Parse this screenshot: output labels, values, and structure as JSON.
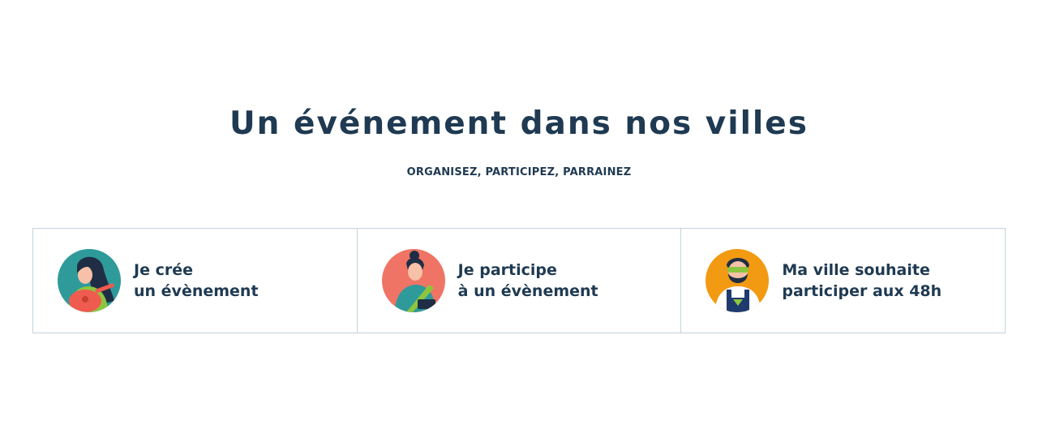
{
  "header": {
    "title": "Un événement dans nos villes",
    "subtitle": "ORGANISEZ, PARTICIPEZ, PARRAINEZ"
  },
  "cards": [
    {
      "line1": "Je crée",
      "line2": "un évènement",
      "avatar_bg": "#2f9a9a",
      "icon": "woman-guitar-icon"
    },
    {
      "line1": "Je participe",
      "line2": "à un évènement",
      "avatar_bg": "#ef7465",
      "icon": "man-bun-icon"
    },
    {
      "line1": "Ma ville souhaite",
      "line2": "participer aux 48h",
      "avatar_bg": "#f29a12",
      "icon": "bearded-hero-icon"
    }
  ],
  "colors": {
    "text": "#1f3a52",
    "border": "#c3d3dc"
  }
}
